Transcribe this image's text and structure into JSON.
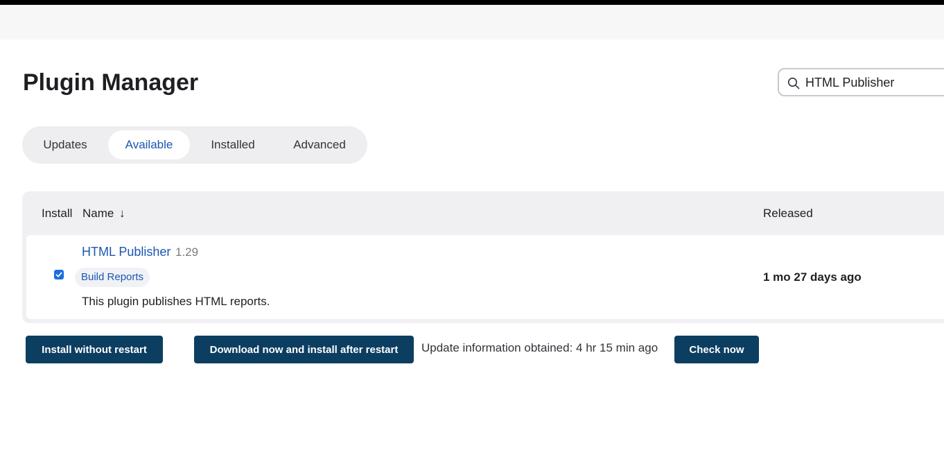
{
  "page": {
    "title": "Plugin Manager"
  },
  "search": {
    "value": "HTML Publisher"
  },
  "tabs": [
    {
      "label": "Updates",
      "active": false
    },
    {
      "label": "Available",
      "active": true
    },
    {
      "label": "Installed",
      "active": false
    },
    {
      "label": "Advanced",
      "active": false
    }
  ],
  "table": {
    "headers": {
      "install": "Install",
      "name": "Name",
      "sort_indicator": "↓",
      "released": "Released"
    },
    "rows": [
      {
        "checked": true,
        "name": "HTML Publisher",
        "version": "1.29",
        "tag": "Build Reports",
        "description": "This plugin publishes HTML reports.",
        "released": "1 mo 27 days ago"
      }
    ]
  },
  "actions": {
    "install_without_restart": "Install without restart",
    "download_and_install": "Download now and install after restart",
    "update_info": "Update information obtained: 4 hr 15 min ago",
    "check_now": "Check now"
  },
  "colors": {
    "accent": "#1b56b0",
    "button": "#0c3e62"
  }
}
